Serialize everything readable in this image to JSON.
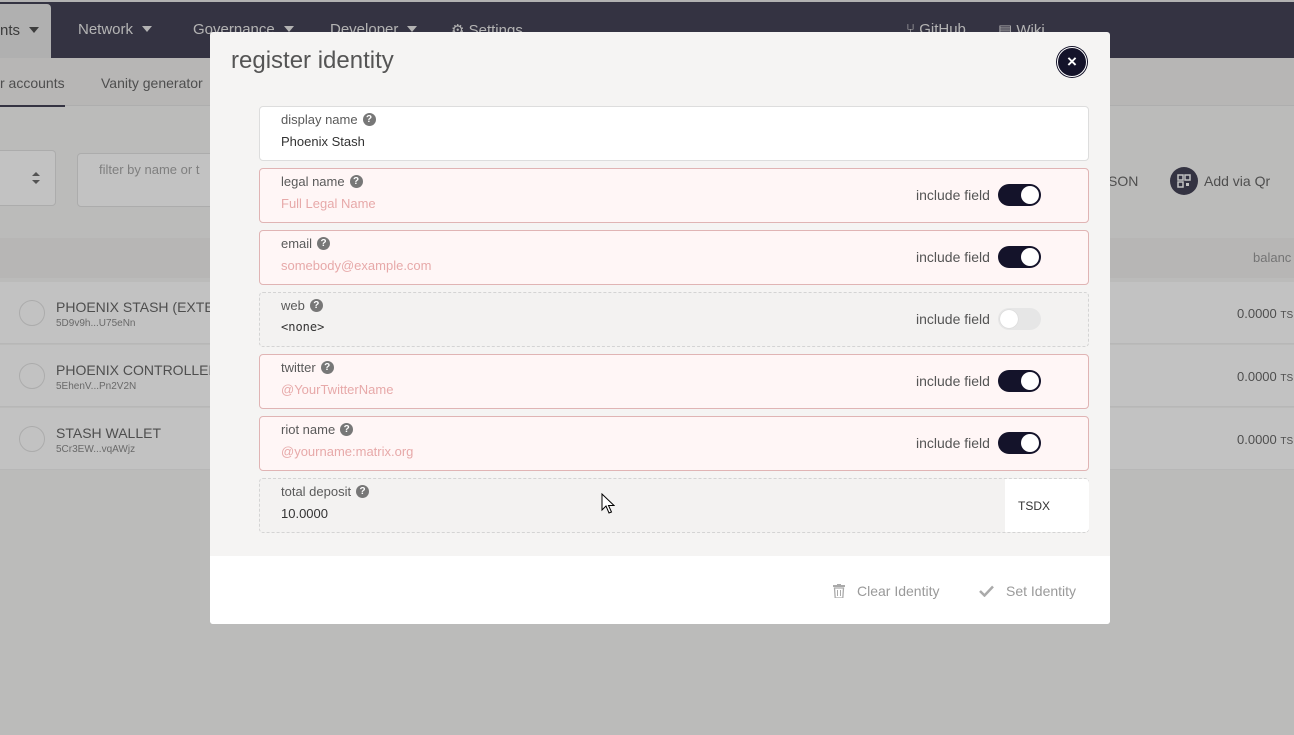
{
  "nav": {
    "items": [
      {
        "label": "nts",
        "active": true
      },
      {
        "label": "Network"
      },
      {
        "label": "Governance"
      },
      {
        "label": "Developer"
      },
      {
        "label": "Settings"
      },
      {
        "label": "GitHub"
      },
      {
        "label": "Wiki"
      }
    ]
  },
  "subnav": {
    "tabs": [
      {
        "label": "r accounts",
        "active": true
      },
      {
        "label": "Vanity generator"
      }
    ]
  },
  "toolbar": {
    "filter_placeholder": "filter by name or t",
    "json_label": "SON",
    "qr_label": "Add via Qr"
  },
  "table": {
    "balance_header": "balanc",
    "rows": [
      {
        "name": "PHOENIX STASH (EXTENS",
        "address": "5D9v9h...U75eNn",
        "balance": "0.0000",
        "unit": "TSI"
      },
      {
        "name": "PHOENIX CONTROLLER (",
        "address": "5EhenV...Pn2V2N",
        "balance": "0.0000",
        "unit": "TSI"
      },
      {
        "name": "STASH WALLET",
        "address": "5Cr3EW...vqAWjz",
        "balance": "0.0000",
        "unit": "TSI"
      }
    ]
  },
  "modal": {
    "title": "register identity",
    "close_symbol": "×",
    "include_label": "include field",
    "fields": {
      "display_name": {
        "label": "display name",
        "value": "Phoenix Stash",
        "placeholder": ""
      },
      "legal_name": {
        "label": "legal name",
        "value": "",
        "placeholder": "Full Legal Name",
        "include": true
      },
      "email": {
        "label": "email",
        "value": "",
        "placeholder": "somebody@example.com",
        "include": true
      },
      "web": {
        "label": "web",
        "value": "<none>",
        "include": false
      },
      "twitter": {
        "label": "twitter",
        "value": "",
        "placeholder": "@YourTwitterName",
        "include": true
      },
      "riot_name": {
        "label": "riot name",
        "value": "",
        "placeholder": "@yourname:matrix.org",
        "include": true
      }
    },
    "deposit": {
      "label": "total deposit",
      "value": "10.0000",
      "unit": "TSDX"
    },
    "footer": {
      "clear_label": "Clear Identity",
      "set_label": "Set Identity"
    }
  },
  "colors": {
    "nav_bg": "#26243b",
    "accent": "#14132a",
    "error_bg": "#fff6f6",
    "error_border": "#e0b4b4",
    "placeholder_error": "#e7a9a9"
  }
}
